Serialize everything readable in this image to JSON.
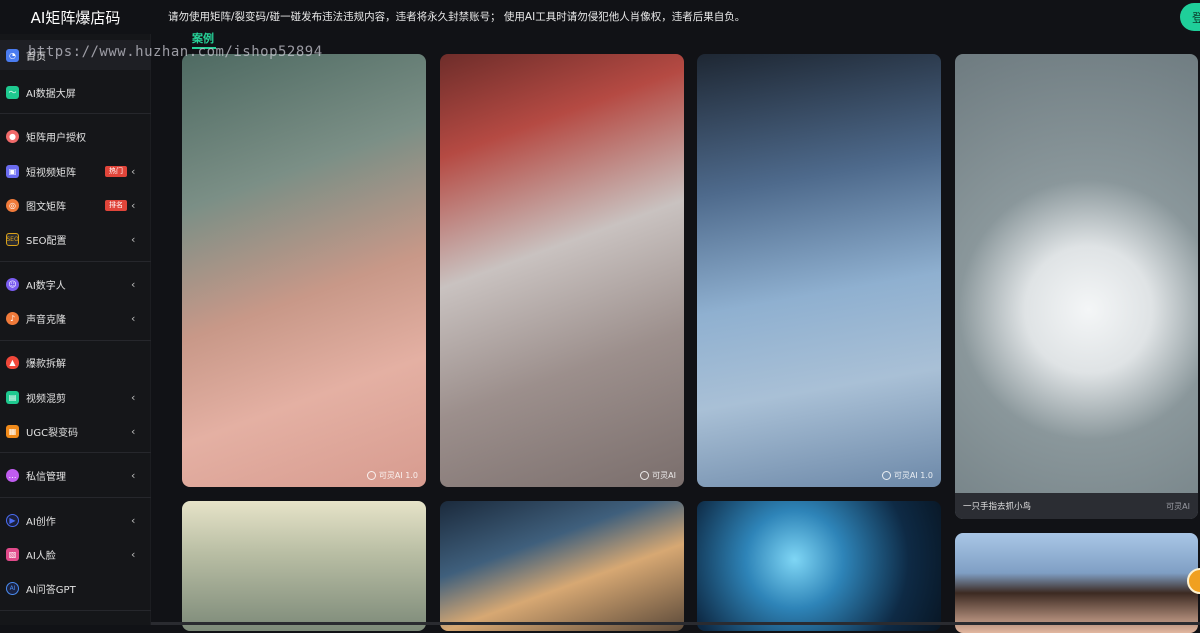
{
  "app": {
    "title": "AI矩阵爆店码",
    "notice": "请勿使用矩阵/裂变码/碰一碰发布违法违规内容，违者将永久封禁账号；  使用AI工具时请勿侵犯他人肖像权，违者后果自负。",
    "login_label": "登"
  },
  "watermark": "https://www.huzhan.com/ishop52894",
  "category_tab": "案例",
  "sidebar": {
    "items": [
      {
        "label": "首页",
        "icon": "home-icon",
        "color": "#4a7cf0",
        "badge": "",
        "chevron": ""
      },
      {
        "label": "AI数据大屏",
        "icon": "chart-icon",
        "color": "#1ec98f",
        "badge": "",
        "chevron": ""
      },
      {
        "label": "矩阵用户授权",
        "icon": "user-key-icon",
        "color": "#f06a6a",
        "badge": "",
        "chevron": ""
      },
      {
        "label": "短视频矩阵",
        "icon": "video-icon",
        "color": "#6b6cf0",
        "badge": "热门",
        "chevron": "‹"
      },
      {
        "label": "图文矩阵",
        "icon": "image-text-icon",
        "color": "#f07a3a",
        "badge": "排名",
        "chevron": "‹"
      },
      {
        "label": "SEO配置",
        "icon": "seo-icon",
        "color": "#d9a21a",
        "badge": "",
        "chevron": "‹"
      },
      {
        "label": "AI数字人",
        "icon": "digital-human-icon",
        "color": "#7a5cf0",
        "badge": "",
        "chevron": "‹"
      },
      {
        "label": "声音克隆",
        "icon": "voice-icon",
        "color": "#f07a3a",
        "badge": "",
        "chevron": "‹"
      },
      {
        "label": "爆款拆解",
        "icon": "fire-icon",
        "color": "#f0473a",
        "badge": "",
        "chevron": ""
      },
      {
        "label": "视频混剪",
        "icon": "film-icon",
        "color": "#1ec98f",
        "badge": "",
        "chevron": "‹"
      },
      {
        "label": "UGC裂变码",
        "icon": "qrcode-icon",
        "color": "#f08a1a",
        "badge": "",
        "chevron": "‹"
      },
      {
        "label": "私信管理",
        "icon": "message-icon",
        "color": "#c05cf0",
        "badge": "",
        "chevron": "‹"
      },
      {
        "label": "AI创作",
        "icon": "play-icon",
        "color": "#4a6cf0",
        "badge": "",
        "chevron": "‹"
      },
      {
        "label": "AI人脸",
        "icon": "face-icon",
        "color": "#e04a8a",
        "badge": "",
        "chevron": "‹"
      },
      {
        "label": "AI问答GPT",
        "icon": "gpt-icon",
        "color": "#4a8cf0",
        "badge": "",
        "chevron": ""
      }
    ]
  },
  "cards": [
    {
      "name": "lotus-girl",
      "badge": "可灵AI 1.0",
      "caption": "",
      "bg": "linear-gradient(160deg,#4e6a62 0%,#7b8f86 30%,#c89888 55%,#e4b0a3 75%,#d79b8f 100%)"
    },
    {
      "name": "snow-girl",
      "badge": "可灵AI",
      "caption": "",
      "bg": "linear-gradient(160deg,#6e2d2a 0%,#b54a43 20%,#c9c2c0 45%,#9c8f8c 70%,#7a6e6c 100%)"
    },
    {
      "name": "dragon-girl",
      "badge": "可灵AI 1.0",
      "caption": "",
      "bg": "linear-gradient(170deg,#1e2733 0%,#4e6a8c 30%,#8fb0d0 55%,#a9c0d6 75%,#6c88a8 100%)"
    },
    {
      "name": "white-bird",
      "badge": "可灵AI",
      "caption": "一只手指去抓小鸟",
      "bg": "radial-gradient(circle at 55% 55%,#f4f6f7 0%,#dfe3e5 22%,#8a979b 45%,#6e7b80 100%)"
    },
    {
      "name": "misty-landscape",
      "badge": "",
      "caption": "",
      "bg": "linear-gradient(180deg,#e6e3c8 0%,#b9bea4 40%,#7d8a79 100%)"
    },
    {
      "name": "glow-girl",
      "badge": "",
      "caption": "",
      "bg": "linear-gradient(160deg,#1b2a3c 0%,#3f5f7c 35%,#d7a873 60%,#5c4a3a 100%)"
    },
    {
      "name": "blue-flower-girl",
      "badge": "",
      "caption": "",
      "bg": "radial-gradient(circle at 40% 45%,#7fd6f5 0%,#2e84b8 30%,#0e2a45 70%,#081624 100%)"
    },
    {
      "name": "portrait-girl",
      "badge": "",
      "caption": "",
      "bg": "linear-gradient(180deg,#a9c6e6 0%,#7f9fc4 40%,#3c2a22 60%,#e2b7a0 100%)"
    }
  ]
}
